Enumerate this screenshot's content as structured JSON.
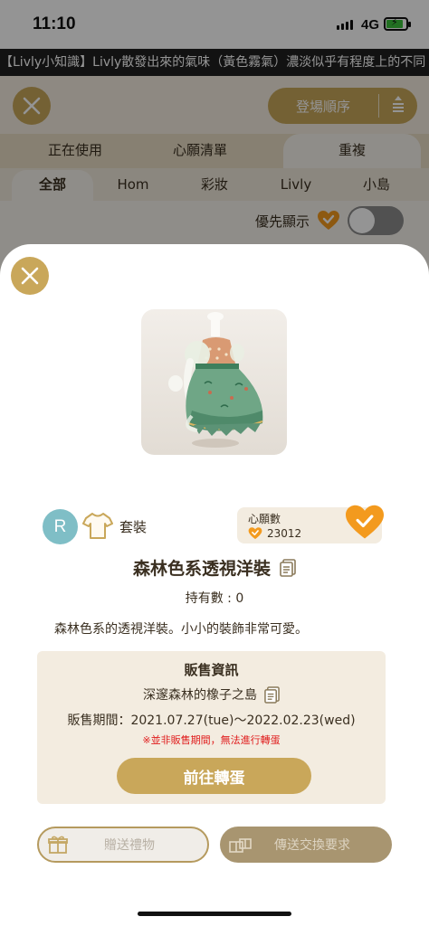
{
  "status_bar": {
    "time": "11:10",
    "network": "4G"
  },
  "ticker": {
    "text": "【Livly小知識】Livly散發出來的氣味（黃色霧氣）濃淡似乎有程度上的不同"
  },
  "header": {
    "sort_label": "登場順序"
  },
  "tabs": [
    {
      "label": "正在使用",
      "active": false
    },
    {
      "label": "心願清單",
      "active": false
    },
    {
      "label": "重複",
      "active": true
    }
  ],
  "subtabs": [
    {
      "label": "全部",
      "active": true
    },
    {
      "label": "Hom",
      "active": false
    },
    {
      "label": "彩妝",
      "active": false
    },
    {
      "label": "Livly",
      "active": false
    },
    {
      "label": "小島",
      "active": false
    }
  ],
  "priority": {
    "label": "優先顯示",
    "enabled": false
  },
  "item": {
    "rank": "R",
    "category": "套裝",
    "wish_title": "心願數",
    "wish_count": "23012",
    "name": "森林色系透視洋裝",
    "owned": "持有數 : 0",
    "description": "森林色系的透視洋裝。小小的裝飾非常可愛。"
  },
  "sale": {
    "title": "販售資訊",
    "island": "深邃森林的橡子之島",
    "period": "販售期間：2021.07.27(tue)～2022.02.23(wed)",
    "warning": "※並非販售期間，無法進行轉蛋",
    "gacha_button": "前往轉蛋"
  },
  "actions": {
    "gift": "贈送禮物",
    "trade": "傳送交換要求"
  },
  "colors": {
    "gold": "#c9a75a",
    "orange_heart": "#f39a1e",
    "rank_teal": "#7fbec6",
    "warning_red": "#e01b1b"
  }
}
